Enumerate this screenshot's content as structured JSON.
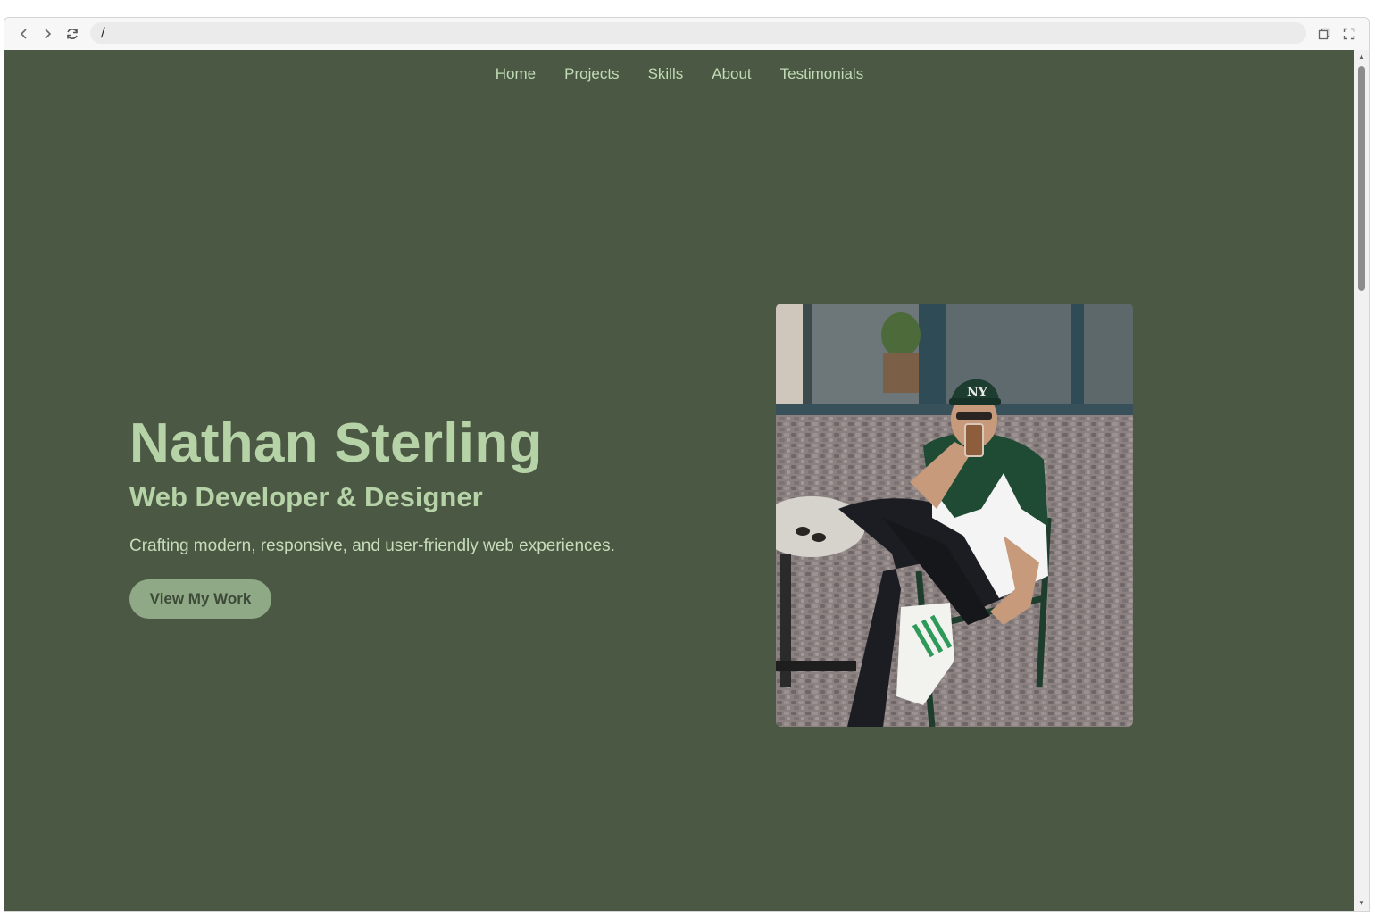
{
  "browser": {
    "url": "/",
    "icons": {
      "back": "chevron-left-icon",
      "forward": "chevron-right-icon",
      "reload": "reload-icon",
      "screenshot": "screenshot-icon",
      "fullscreen": "fullscreen-icon"
    }
  },
  "nav": {
    "items": [
      {
        "label": "Home"
      },
      {
        "label": "Projects"
      },
      {
        "label": "Skills"
      },
      {
        "label": "About"
      },
      {
        "label": "Testimonials"
      }
    ]
  },
  "hero": {
    "name": "Nathan Sterling",
    "role": "Web Developer & Designer",
    "tagline": "Crafting modern, responsive, and user-friendly web experiences.",
    "cta_label": "View My Work",
    "photo_alt": "Portrait photo"
  },
  "colors": {
    "page_background": "#4b5843",
    "heading": "#b6d3a8",
    "nav_text": "#c1dcb6",
    "button_bg": "#8fa886",
    "button_text": "#3c4a37"
  }
}
